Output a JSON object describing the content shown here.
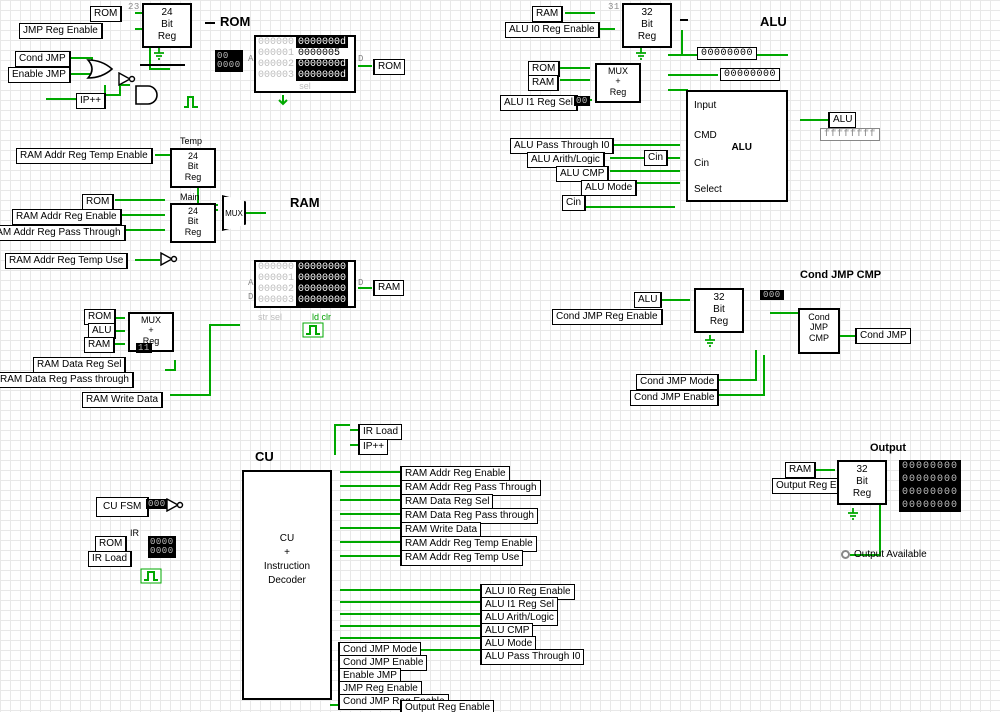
{
  "sections": {
    "rom": "ROM",
    "ram": "RAM",
    "alu": "ALU",
    "condJmpCmp": "Cond JMP CMP",
    "output": "Output",
    "cu": "CU"
  },
  "blocks": {
    "reg24": "24\nBit\nReg",
    "reg32": "32\nBit\nReg",
    "muxReg": "MUX\n+\nReg",
    "alu": "ALU",
    "condJmpCmp": "Cond\nJMP\nCMP",
    "cuDecoder": "CU\n+\nInstruction\nDecoder",
    "cuFsm": "CU FSM"
  },
  "labels": {
    "temp": "Temp",
    "main": "Main",
    "top31": "31",
    "top23": "23",
    "ir": "IR",
    "mux": "MUX"
  },
  "pins": {
    "rom_in": [
      "ROM",
      "JMP Reg Enable",
      "Cond JMP",
      "Enable JMP",
      "IP++"
    ],
    "rom_out": "ROM",
    "ram_in_top": [
      "RAM Addr Reg Temp Enable"
    ],
    "ram_in_mid": [
      "ROM",
      "RAM Addr Reg Enable",
      "RAM Addr Reg Pass Through"
    ],
    "ram_addr_temp_use": "RAM Addr Reg Temp Use",
    "ram_mux_in": [
      "ROM",
      "ALU",
      "RAM"
    ],
    "ram_data_sel": [
      "RAM Data Reg Sel",
      "RAM Data Reg Pass through"
    ],
    "ram_write": "RAM Write Data",
    "ram_out": "RAM",
    "alu_top_in": [
      "RAM",
      "ALU I0 Reg Enable"
    ],
    "alu_mux_in": [
      "ROM",
      "RAM"
    ],
    "alu_i1_sel": "ALU I1 Reg Sel",
    "alu_flags": [
      "ALU Pass Through I0",
      "ALU Arith/Logic",
      "ALU CMP",
      "ALU Mode"
    ],
    "alu_cin": "Cin",
    "alu_ports": [
      "Input",
      "CMD",
      "Cin",
      "Select"
    ],
    "alu_out": "ALU",
    "alu_cin_small": "Cin",
    "cond_in": [
      "ALU",
      "Cond JMP Reg Enable"
    ],
    "cond_bottom": [
      "Cond JMP Mode",
      "Cond JMP Enable"
    ],
    "cond_out": "Cond JMP",
    "output_in": [
      "RAM",
      "Output Reg Enable"
    ],
    "output_available": "Output Available",
    "cu_ir_in": [
      "ROM",
      "IR Load"
    ],
    "cu_top": [
      "IR Load",
      "IP++"
    ],
    "cu_ram_group": [
      "RAM Addr Reg Enable",
      "RAM Addr Reg Pass Through",
      "RAM Data Reg Sel",
      "RAM Data Reg Pass through",
      "RAM Write Data",
      "RAM Addr Reg Temp Enable",
      "RAM Addr Reg Temp Use"
    ],
    "cu_alu_group": [
      "ALU I0 Reg Enable",
      "ALU I1 Reg Sel",
      "ALU Arith/Logic",
      "ALU CMP",
      "ALU Mode",
      "ALU Pass Through I0"
    ],
    "cu_jmp_group": [
      "Cond JMP Mode",
      "Cond JMP Enable",
      "Enable JMP",
      "JMP Reg Enable",
      "Cond JMP Reg Enable"
    ],
    "cu_out_group": [
      "Output Reg Enable"
    ]
  },
  "values": {
    "rom_addr_in": "00\n0000",
    "rom_mem_addrs": [
      "000000",
      "000001",
      "000002",
      "000003"
    ],
    "rom_mem_data": [
      "0000000d",
      "0000005",
      "0000000d",
      "0000000d"
    ],
    "ram_mem_addrs": [
      "000000",
      "000001",
      "000002",
      "000003"
    ],
    "ram_mem_data": [
      "00000000",
      "00000000",
      "00000000",
      "00000000"
    ],
    "mem_sel": "sel",
    "mem_strsel": "str sel",
    "mem_ldclr": "ld  clr",
    "ram_mux_sel": "11",
    "alu_bus0": "00000000",
    "alu_bus1": "00000000",
    "alu_i1_sel_val": "00",
    "alu_out_val": "ffffffff",
    "cond_bus": "000",
    "cu_fsm_val": "000",
    "ir_val": "0000\n0000",
    "seg7_rows": [
      "00000000",
      "00000000",
      "00000000",
      "00000000"
    ],
    "ram_port_a": "A",
    "ram_port_d_top": "D",
    "rom_port_a": "A",
    "rom_port_d": "D",
    "ram_port_d_right": "D"
  }
}
